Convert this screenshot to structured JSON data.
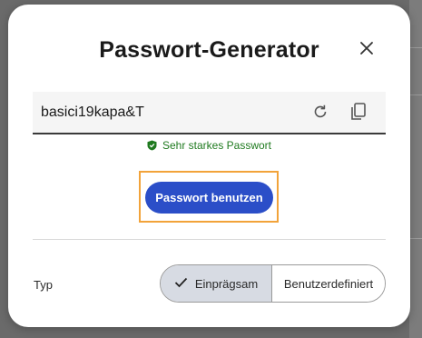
{
  "dialog": {
    "title": "Passwort-Generator",
    "close_icon": "close-icon"
  },
  "password": {
    "value": "basici19kapa&T",
    "regenerate_icon": "refresh-icon",
    "copy_icon": "copy-icon"
  },
  "strength": {
    "icon": "shield-check-icon",
    "text": "Sehr starkes Passwort",
    "color": "#1f7a1f"
  },
  "actions": {
    "use_label": "Passwort benutzen",
    "accent": "#2b4ec8",
    "focus_color": "#f2a33a"
  },
  "type": {
    "label": "Typ",
    "options": [
      {
        "label": "Einprägsam",
        "selected": true
      },
      {
        "label": "Benutzerdefiniert",
        "selected": false
      }
    ]
  }
}
